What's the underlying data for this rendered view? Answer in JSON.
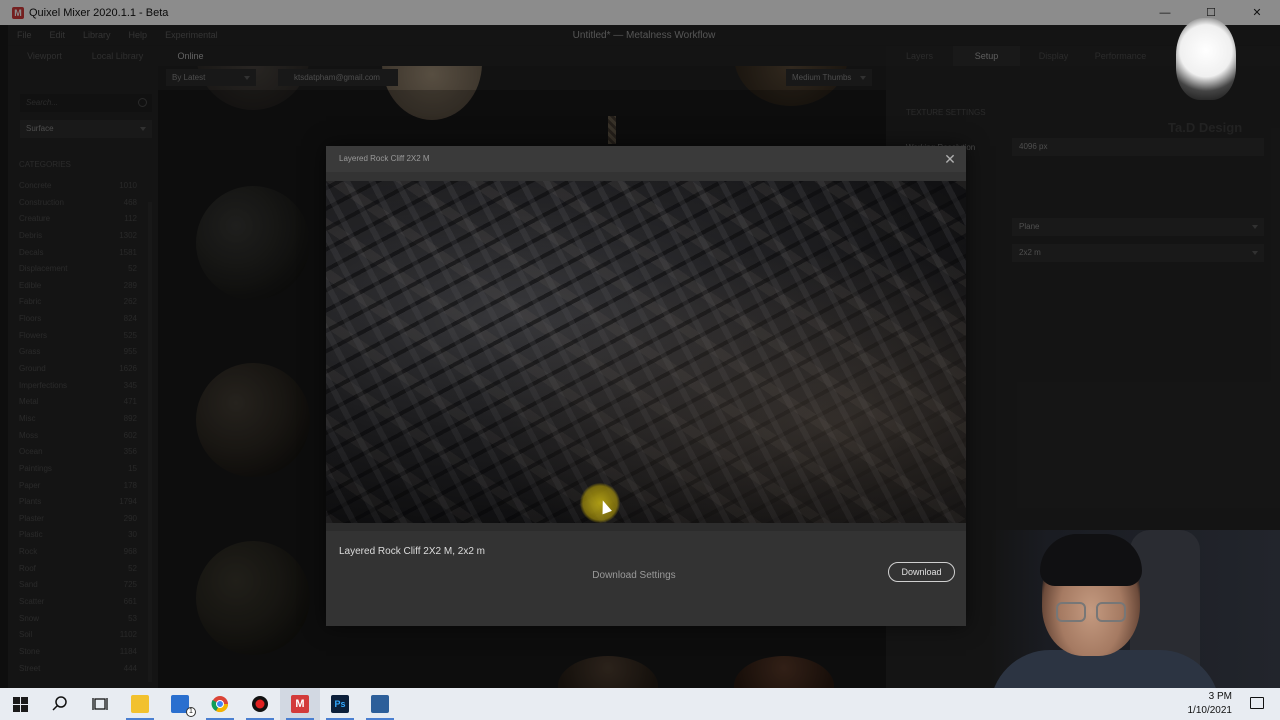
{
  "window": {
    "app_title": "Quixel Mixer 2020.1.1 - Beta",
    "document_title": "Untitled* — Metalness Workflow",
    "controls": {
      "minimize": "—",
      "maximize": "☐",
      "close": "✕"
    }
  },
  "menu": [
    "File",
    "Edit",
    "Library",
    "Help",
    "Experimental"
  ],
  "left_tabs": [
    {
      "label": "Viewport",
      "active": false
    },
    {
      "label": "Local Library",
      "active": false
    },
    {
      "label": "Online",
      "active": true
    }
  ],
  "sidebar": {
    "search_placeholder": "Search...",
    "type_select": "Surface",
    "categories_heading": "CATEGORIES",
    "categories": [
      {
        "name": "Concrete",
        "count": "1010"
      },
      {
        "name": "Construction",
        "count": "468"
      },
      {
        "name": "Creature",
        "count": "112"
      },
      {
        "name": "Debris",
        "count": "1302"
      },
      {
        "name": "Decals",
        "count": "1581"
      },
      {
        "name": "Displacement",
        "count": "52"
      },
      {
        "name": "Edible",
        "count": "289"
      },
      {
        "name": "Fabric",
        "count": "262"
      },
      {
        "name": "Floors",
        "count": "824"
      },
      {
        "name": "Flowers",
        "count": "525"
      },
      {
        "name": "Grass",
        "count": "955"
      },
      {
        "name": "Ground",
        "count": "1626"
      },
      {
        "name": "Imperfections",
        "count": "345"
      },
      {
        "name": "Metal",
        "count": "471"
      },
      {
        "name": "Misc",
        "count": "892"
      },
      {
        "name": "Moss",
        "count": "602"
      },
      {
        "name": "Ocean",
        "count": "356"
      },
      {
        "name": "Paintings",
        "count": "15"
      },
      {
        "name": "Paper",
        "count": "178"
      },
      {
        "name": "Plants",
        "count": "1794"
      },
      {
        "name": "Plaster",
        "count": "290"
      },
      {
        "name": "Plastic",
        "count": "30"
      },
      {
        "name": "Rock",
        "count": "968"
      },
      {
        "name": "Roof",
        "count": "52"
      },
      {
        "name": "Sand",
        "count": "725"
      },
      {
        "name": "Scatter",
        "count": "661"
      },
      {
        "name": "Snow",
        "count": "53"
      },
      {
        "name": "Soil",
        "count": "1102"
      },
      {
        "name": "Stone",
        "count": "1184"
      },
      {
        "name": "Street",
        "count": "444"
      }
    ]
  },
  "grid_toolbar": {
    "sort": "By Latest",
    "account": "ktsdatpham@gmail.com",
    "thumb_size": "Medium Thumbs"
  },
  "right_tabs": [
    {
      "label": "Layers",
      "active": false
    },
    {
      "label": "Setup",
      "active": true
    },
    {
      "label": "Display",
      "active": false
    },
    {
      "label": "Performance",
      "active": false
    }
  ],
  "setup": {
    "texture_settings_heading": "TEXTURE SETTINGS",
    "working_resolution_label": "Working Resolution",
    "working_resolution_value": "4096 px",
    "model_value": "Plane",
    "size_value": "2x2 m"
  },
  "watermark": {
    "text": "Ta.D  Design"
  },
  "modal": {
    "title": "Layered Rock Cliff 2X2 M",
    "close": "✕",
    "asset_name": "Layered Rock Cliff 2X2 M, 2x2 m",
    "download_settings": "Download Settings",
    "download_button": "Download"
  },
  "taskbar": {
    "clock_time": "3 PM",
    "clock_date": "1/10/2021",
    "mail_badge": "1"
  },
  "colors": {
    "accent_logo": "#d33a3a",
    "cursor_highlight": "#c8b414"
  }
}
